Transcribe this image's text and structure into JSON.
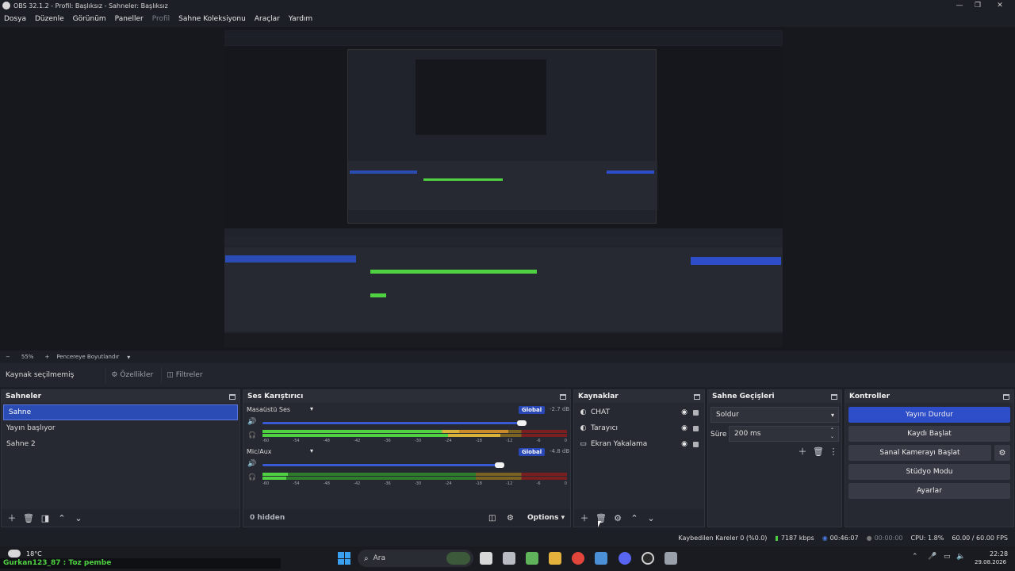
{
  "window": {
    "title": "OBS 32.1.2 - Profil: Başlıksız - Sahneler: Başlıksız"
  },
  "menu": [
    "Dosya",
    "Düzenle",
    "Görünüm",
    "Paneller",
    "Profil",
    "Sahne Koleksiyonu",
    "Araçlar",
    "Yardım"
  ],
  "zoom": {
    "minus": "−",
    "value": "55%",
    "plus": "+",
    "fit_label": "Pencereye Boyutlandır"
  },
  "source_bar": {
    "label": "Kaynak seçilmemiş",
    "properties": "Özellikler",
    "filters": "Filtreler"
  },
  "scenes": {
    "title": "Sahneler",
    "items": [
      "Sahne",
      "Yayın başlıyor",
      "Sahne 2"
    ],
    "selected": 0
  },
  "mixer": {
    "title": "Ses Karıştırıcı",
    "channels": [
      {
        "name": "Masaüstü Ses",
        "badge": "Global",
        "db": "-2.7 dB",
        "level": 0.94
      },
      {
        "name": "Mic/Aux",
        "badge": "Global",
        "db": "-4.8 dB",
        "level": 0.88
      }
    ],
    "ticks": [
      "-60",
      "-54",
      "-48",
      "-42",
      "-36",
      "-30",
      "-24",
      "-18",
      "-12",
      "-6",
      "0"
    ],
    "hidden_label": "0 hidden",
    "options_label": "Options"
  },
  "sources": {
    "title": "Kaynaklar",
    "items": [
      {
        "name": "CHAT",
        "icon": "globe-icon"
      },
      {
        "name": "Tarayıcı",
        "icon": "globe-icon"
      },
      {
        "name": "Ekran Yakalama",
        "icon": "monitor-icon"
      }
    ]
  },
  "transitions": {
    "title": "Sahne Geçişleri",
    "type": "Soldur",
    "duration_label": "Süre",
    "duration_value": "200 ms"
  },
  "controls": {
    "title": "Kontroller",
    "buttons": [
      "Yayını Durdur",
      "Kaydı Başlat",
      "Sanal Kamerayı Başlat",
      "Stüdyo Modu",
      "Ayarlar"
    ]
  },
  "status": {
    "dropped": "Kaybedilen Kareler 0 (%0.0)",
    "bitrate": "7187 kbps",
    "stream_time": "00:46:07",
    "rec_time": "00:00:00",
    "cpu": "CPU: 1.8%",
    "fps": "60.00 / 60.00 FPS"
  },
  "taskbar": {
    "weather": "18°C",
    "ticker": "Gurkan123_87 : Toz pembe",
    "search": "Ara",
    "time": "22:28",
    "date": "29.08.2026"
  },
  "colors": {
    "accent": "#2e4dc8",
    "meter_green": "#4fd142",
    "meter_yellow": "#d9b23a",
    "meter_red": "#c23a3a"
  }
}
